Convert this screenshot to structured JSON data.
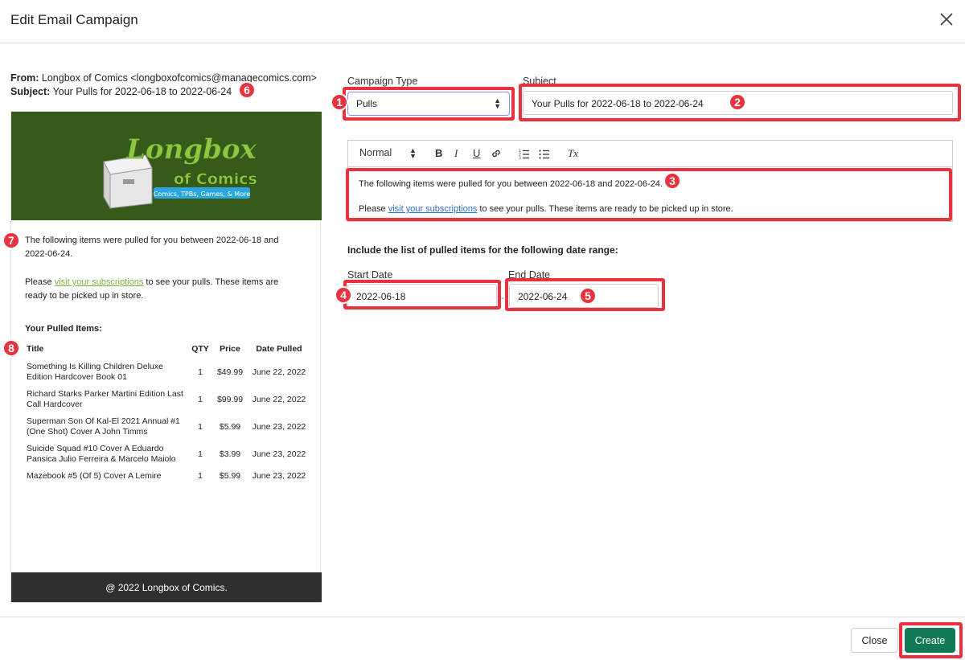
{
  "dialog": {
    "title": "Edit Email Campaign"
  },
  "preview": {
    "from_label": "From:",
    "from_value": "Longbox of Comics <longboxofcomics@managecomics.com>",
    "subject_label": "Subject:",
    "subject_value": "Your Pulls for 2022-06-18 to 2022-06-24",
    "logo": {
      "line1": "Longbox",
      "line2": "of Comics",
      "tagline": "Comics, TPBs, Games, & More"
    },
    "paragraph1": "The following items were pulled for you between 2022-06-18 and 2022-06-24.",
    "paragraph2_prefix": "Please ",
    "paragraph2_link": "visit your subscriptions",
    "paragraph2_suffix": " to see your pulls. These items are ready to be picked up in store.",
    "pulled_heading": "Your Pulled Items:",
    "columns": [
      "Title",
      "QTY",
      "Price",
      "Date Pulled"
    ],
    "items": [
      [
        "Something Is Killing Children Deluxe Edition Hardcover Book 01",
        "1",
        "$49.99",
        "June 22, 2022"
      ],
      [
        "Richard Starks Parker Martini Edition Last Call Hardcover",
        "1",
        "$99.99",
        "June 22, 2022"
      ],
      [
        "Superman Son Of Kal-El 2021 Annual #1 (One Shot) Cover A John Timms",
        "1",
        "$5.99",
        "June 23, 2022"
      ],
      [
        "Suicide Squad #10 Cover A Eduardo Pansica Julio Ferreira & Marcelo Maiolo",
        "1",
        "$3.99",
        "June 23, 2022"
      ],
      [
        "Mazebook #5 (Of 5) Cover A Lemire",
        "1",
        "$5.99",
        "June 23, 2022"
      ]
    ],
    "footer": "@ 2022 Longbox of Comics."
  },
  "form": {
    "campaign_type_label": "Campaign Type",
    "campaign_type_value": "Pulls",
    "subject_label": "Subject",
    "subject_value": "Your Pulls for 2022-06-18 to 2022-06-24",
    "toolbar": {
      "format": "Normal",
      "bold": "B",
      "italic": "I",
      "underline": "U",
      "clear": "Tx"
    },
    "body_p1": "The following items were pulled for you between 2022-06-18 and 2022-06-24.",
    "body_p2_prefix": "Please ",
    "body_p2_link": "visit your subscriptions",
    "body_p2_suffix": " to see your pulls. These items are ready to be picked up in store.",
    "range_heading": "Include the list of pulled items for the following date range:",
    "start_label": "Start Date",
    "start_value": "2022-06-18",
    "end_label": "End Date",
    "end_value": "2022-06-24",
    "range_separator": "-"
  },
  "buttons": {
    "close": "Close",
    "create": "Create"
  },
  "badges": [
    "1",
    "2",
    "3",
    "4",
    "5",
    "6",
    "7",
    "8"
  ],
  "colors": {
    "annotation": "#e8323f",
    "create_button": "#0f7a55",
    "banner": "#365a1a",
    "link_green": "#7db33c",
    "link_blue": "#2a6ed1"
  }
}
